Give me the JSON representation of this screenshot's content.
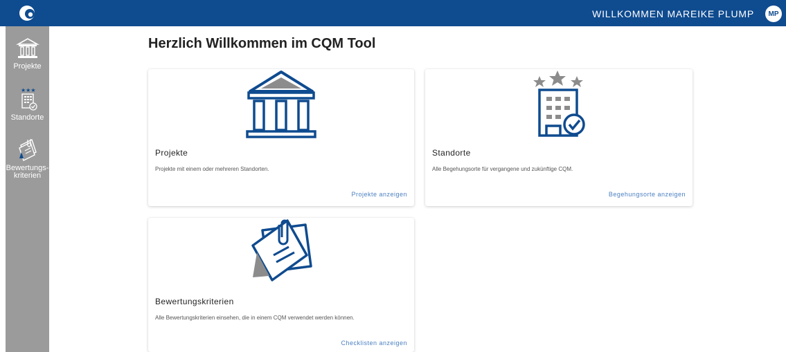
{
  "header": {
    "welcome_text": "WILLKOMMEN MAREIKE PLUMP",
    "avatar_initials": "MP"
  },
  "sidebar": {
    "items": [
      {
        "label": "Projekte"
      },
      {
        "label": "Standorte"
      },
      {
        "label_line1": "Bewertungs-",
        "label_line2": "kriterien"
      }
    ]
  },
  "main": {
    "title": "Herzlich Willkommen im CQM Tool",
    "cards": [
      {
        "title": "Projekte",
        "description": "Projekte mit einem oder mehreren Standorten.",
        "action": "Projekte anzeigen"
      },
      {
        "title": "Standorte",
        "description": "Alle Begehungsorte für vergangene und zukünftige CQM.",
        "action": "Begehungsorte anzeigen"
      },
      {
        "title": "Bewertungskriterien",
        "description": "Alle Bewertungskriterien einsehen, die in einem CQM verwendet werden können.",
        "action": "Checklisten anzeigen"
      }
    ]
  },
  "colors": {
    "brand_blue": "#0f4b8f",
    "sidebar_gray": "#9b9b9b",
    "link_blue": "#4a7fc0",
    "icon_gray": "#8c8c8c"
  },
  "icons": {
    "logo": "app-logo-icon",
    "projekte": "building-columns-icon",
    "standorte": "building-stars-check-icon",
    "bewertung": "clipped-documents-icon"
  }
}
